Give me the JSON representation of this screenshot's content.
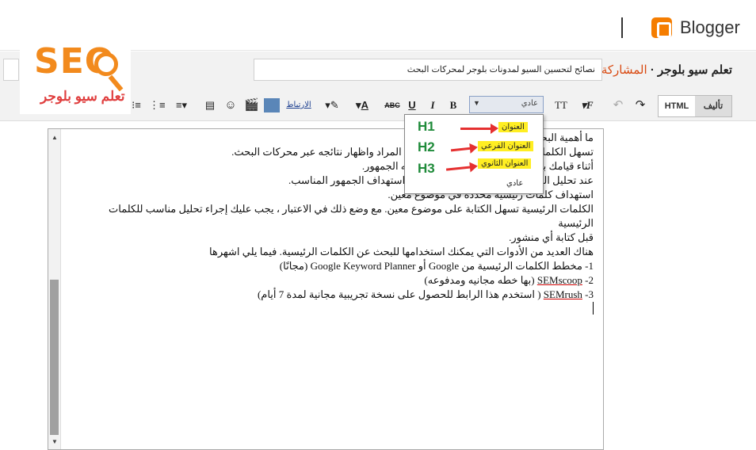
{
  "app": {
    "name": "Blogger",
    "blog_title": "تعلم سيو بلوجر",
    "separator": "·",
    "post_word": "المشاركة"
  },
  "post": {
    "title_value": "نصائح لتحسين السيو لمدونات بلوجر لمحركات البحث"
  },
  "toolbar": {
    "compose_tab": "تأليف",
    "html_tab": "HTML",
    "style_selected": "عادي",
    "link_label": "الارتباط",
    "strikethrough": "ABC",
    "underline": "U",
    "italic": "I",
    "bold": "B",
    "font_size": "TT",
    "font": "F",
    "text_color": "A",
    "icons": [
      "undo-icon",
      "redo-icon",
      "text-color-icon",
      "highlight-icon",
      "image-icon",
      "video-icon",
      "emoji-icon",
      "jump-break-icon",
      "align-icon",
      "numbered-list-icon",
      "bullet-list-icon"
    ]
  },
  "style_dropdown": {
    "options": [
      {
        "label": "العنوان",
        "badge": "H1"
      },
      {
        "label": "العنوان الفرعي",
        "badge": "H2"
      },
      {
        "label": "العنوان الثانوي",
        "badge": "H3"
      },
      {
        "label": "عادي",
        "badge": ""
      }
    ]
  },
  "editor": {
    "lines": [
      "ما أهمية البحث",
      "تسهل الكلمات الرئيسية الوصول إلى المحتوى المراد واظهار نتائجه عبر محركات البحث.",
      "أثناء قيامك بالكتابة يجب أن تعرف ما يبحث عنه الجمهور.",
      "عند تحليل الكلمات الرئيسية يكون من السهل استهداف الجمهور المناسب.",
      "استهداف كلمات رئيسية محددة في موضوع معين.",
      "الكلمات الرئيسية تسهل الكتابة على موضوع معين. مع وضع ذلك في الاعتبار ، يجب عليك إجراء تحليل مناسب للكلمات الرئيسية",
      "قبل كتابة أي منشور.",
      "هناك العديد من الأدوات التي يمكنك استخدامها للبحث عن الكلمات الرئيسية. فيما يلي اشهرها"
    ],
    "list": [
      {
        "prefix": "1- مخطط الكلمات الرئيسية من Google أو",
        "tool": "Google Keyword Planner",
        "suffix": "(مجانًا)"
      },
      {
        "prefix": "2-",
        "tool": "SEMscoop",
        "suffix": "(بها خطه مجانيه ومدفوعه)"
      },
      {
        "prefix": "3-",
        "tool": "SEMrush",
        "suffix": "( استخدم هذا الرابط للحصول على نسخة تجريبية مجانية لمدة 7 أيام)"
      }
    ]
  },
  "watermark": {
    "logo_text": "SEO",
    "tagline": "تعلم سيو بلوجر"
  },
  "colors": {
    "accent_orange": "#f57d00",
    "post_red": "#d9480f",
    "highlight_yellow": "#ffee22",
    "heading_green": "#1f8b3a",
    "arrow_red": "#e53030"
  }
}
